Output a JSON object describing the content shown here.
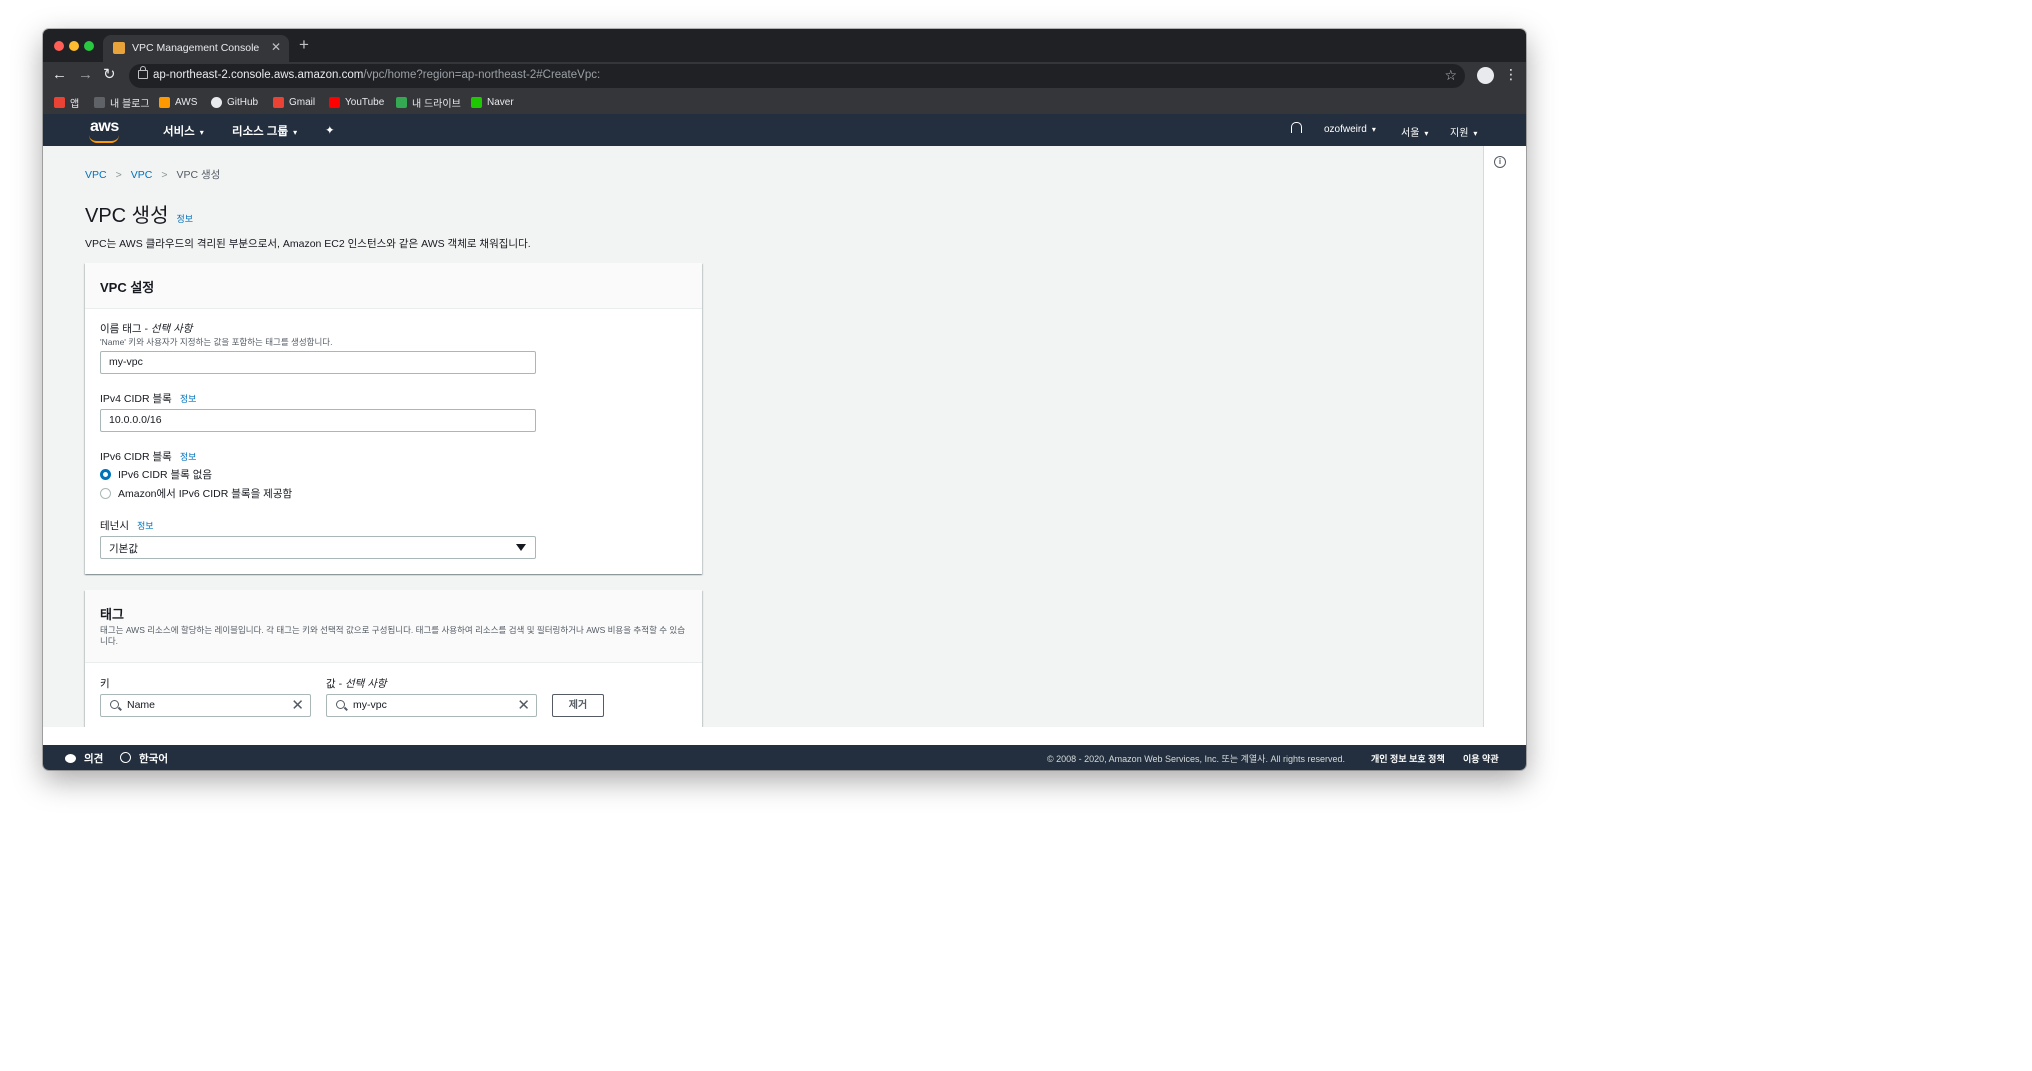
{
  "browser": {
    "tab_title": "VPC Management Console",
    "tab_close": "✕",
    "new_tab": "+",
    "url_host": "ap-northeast-2.console.aws.amazon.com",
    "url_path": "/vpc/home?region=ap-northeast-2#CreateVpc:",
    "back": "←",
    "forward": "→",
    "reload": "↻",
    "star": "☆",
    "menu": "⋮",
    "bookmarks": [
      {
        "label": "앱",
        "color": "#ea4335"
      },
      {
        "label": "내 블로그",
        "color": "#5f6368"
      },
      {
        "label": "AWS",
        "color": "#ff9900"
      },
      {
        "label": "GitHub",
        "color": "#e8eaed"
      },
      {
        "label": "Gmail",
        "color": "#ea4335"
      },
      {
        "label": "YouTube",
        "color": "#ff0000"
      },
      {
        "label": "내 드라이브",
        "color": "#34a853"
      },
      {
        "label": "Naver",
        "color": "#1ec800"
      }
    ]
  },
  "aws_nav": {
    "logo": "aws",
    "services": "서비스",
    "resource_groups": "리소스 그룹",
    "pin": "✦",
    "username": "ozofweird",
    "region": "서울",
    "support": "지원",
    "caret": "▾"
  },
  "breadcrumb": [
    "VPC",
    "VPC",
    "VPC 생성"
  ],
  "breadcrumb_sep": ">",
  "page": {
    "title": "VPC 생성",
    "info": "정보",
    "description": "VPC는 AWS 클라우드의 격리된 부분으로서, Amazon EC2 인스턴스와 같은 AWS 객체로 채워집니다."
  },
  "vpc_settings": {
    "title": "VPC 설정",
    "name_tag_label": "이름 태그 - ",
    "name_tag_optional": "선택 사항",
    "name_tag_hint": "'Name' 키와 사용자가 지정하는 값을 포함하는 태그를 생성합니다.",
    "name_tag_value": "my-vpc",
    "ipv4_label": "IPv4 CIDR 블록",
    "ipv4_value": "10.0.0.0/16",
    "ipv6_label": "IPv6 CIDR 블록",
    "ipv6_options": [
      "IPv6 CIDR 블록 없음",
      "Amazon에서 IPv6 CIDR 블록을 제공함"
    ],
    "ipv6_selected": 0,
    "tenancy_label": "테넌시",
    "tenancy_value": "기본값",
    "info": "정보"
  },
  "tags": {
    "title": "태그",
    "description": "태그는 AWS 리소스에 할당하는 레이블입니다. 각 태그는 키와 선택적 값으로 구성됩니다. 태그를 사용하여 리소스를 검색 및 필터링하거나 AWS 비용을 추적할 수 있습니다.",
    "key_label": "키",
    "value_label": "값 - ",
    "value_optional": "선택 사항",
    "key_value": "Name",
    "value_value": "my-vpc",
    "remove": "제거",
    "clear": "✕"
  },
  "footer": {
    "feedback": "의견",
    "language": "한국어",
    "copyright": "© 2008 - 2020, Amazon Web Services, Inc. 또는 계열사. All rights reserved.",
    "privacy": "개인 정보 보호 정책",
    "terms": "이용 약관"
  }
}
